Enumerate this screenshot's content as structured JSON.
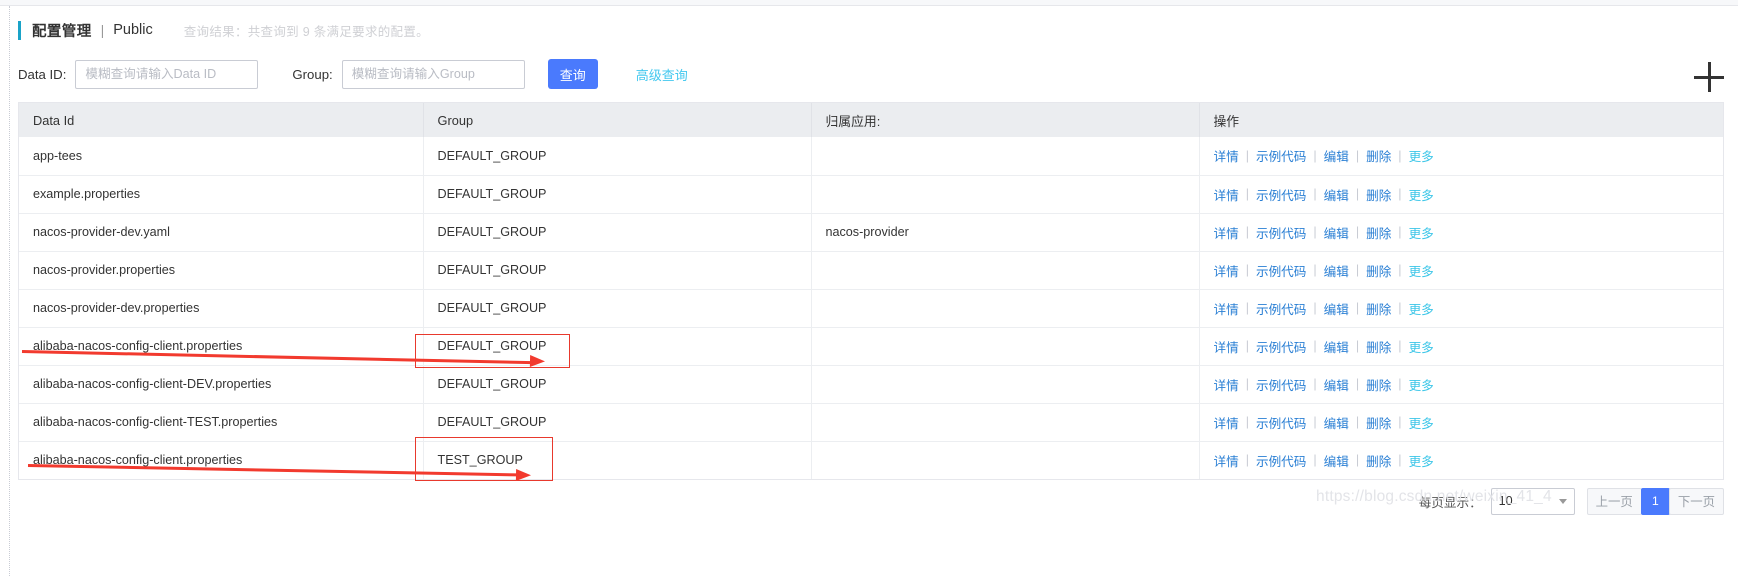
{
  "header": {
    "title": "配置管理",
    "separator": "|",
    "namespace": "Public",
    "result_hint": "查询结果：共查询到 9 条满足要求的配置。"
  },
  "search": {
    "dataid_label": "Data ID:",
    "dataid_value": "",
    "dataid_placeholder": "模糊查询请输入Data ID",
    "group_label": "Group:",
    "group_value": "",
    "group_placeholder": "模糊查询请输入Group",
    "query_button": "查询",
    "advanced_link": "高级查询",
    "add_icon": "plus-icon"
  },
  "table": {
    "columns": [
      "Data Id",
      "Group",
      "归属应用:",
      "操作"
    ],
    "operations": {
      "detail": "详情",
      "sample_code": "示例代码",
      "edit": "编辑",
      "delete": "删除",
      "more": "更多",
      "divider": "|"
    },
    "rows": [
      {
        "data_id": "app-tees",
        "group": "DEFAULT_GROUP",
        "app": ""
      },
      {
        "data_id": "example.properties",
        "group": "DEFAULT_GROUP",
        "app": ""
      },
      {
        "data_id": "nacos-provider-dev.yaml",
        "group": "DEFAULT_GROUP",
        "app": "nacos-provider"
      },
      {
        "data_id": "nacos-provider.properties",
        "group": "DEFAULT_GROUP",
        "app": ""
      },
      {
        "data_id": "nacos-provider-dev.properties",
        "group": "DEFAULT_GROUP",
        "app": ""
      },
      {
        "data_id": "alibaba-nacos-config-client.properties",
        "group": "DEFAULT_GROUP",
        "app": ""
      },
      {
        "data_id": "alibaba-nacos-config-client-DEV.properties",
        "group": "DEFAULT_GROUP",
        "app": ""
      },
      {
        "data_id": "alibaba-nacos-config-client-TEST.properties",
        "group": "DEFAULT_GROUP",
        "app": ""
      },
      {
        "data_id": "alibaba-nacos-config-client.properties",
        "group": "TEST_GROUP",
        "app": ""
      }
    ]
  },
  "footer": {
    "page_size_label": "每页显示：",
    "page_size_value": "10",
    "prev_label": "上一页",
    "page_number": "1",
    "next_label": "下一页"
  },
  "watermark": {
    "text": "https://blog.csdn.net/weixin_41_4"
  },
  "colors": {
    "accent_blue": "#4a7afd",
    "link_blue": "#2a7fd4",
    "link_cyan": "#44c8ef",
    "title_bar": "#1aa3c8",
    "annotation_red": "#f23a2e"
  }
}
